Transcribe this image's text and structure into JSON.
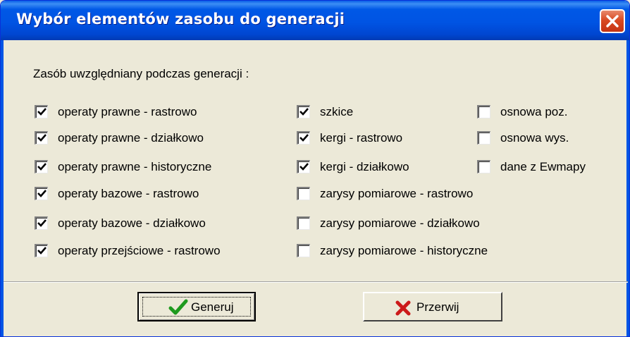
{
  "window": {
    "title": "Wybór elementów zasobu do generacji"
  },
  "group": {
    "label": "Zasób  uwzględniany podczas generacji :"
  },
  "checkboxes": {
    "col1": [
      {
        "label": "operaty prawne - rastrowo",
        "checked": true
      },
      {
        "label": "operaty prawne - działkowo",
        "checked": true
      },
      {
        "label": "operaty prawne - historyczne",
        "checked": true
      },
      {
        "label": "operaty bazowe - rastrowo",
        "checked": true
      },
      {
        "label": "operaty bazowe - działkowo",
        "checked": true
      },
      {
        "label": "operaty przejściowe - rastrowo",
        "checked": true
      }
    ],
    "col2": [
      {
        "label": "szkice",
        "checked": true
      },
      {
        "label": "kergi - rastrowo",
        "checked": true
      },
      {
        "label": "kergi - działkowo",
        "checked": true
      },
      {
        "label": "zarysy pomiarowe - rastrowo",
        "checked": false
      },
      {
        "label": "zarysy pomiarowe - działkowo",
        "checked": false
      },
      {
        "label": "zarysy pomiarowe - historyczne",
        "checked": false
      }
    ],
    "col3": [
      {
        "label": "osnowa poz.",
        "checked": false
      },
      {
        "label": "osnowa wys.",
        "checked": false
      },
      {
        "label": "dane z Ewmapy",
        "checked": false
      }
    ]
  },
  "buttons": {
    "generate": {
      "label": "Generuj",
      "icon": "checkmark-icon",
      "color": "#1e9a1e"
    },
    "cancel": {
      "label": "Przerwij",
      "icon": "x-icon",
      "color": "#cc1a1a"
    }
  },
  "colors": {
    "titlebar": "#0054e3",
    "face": "#ece9d8",
    "close": "#d94a22"
  }
}
